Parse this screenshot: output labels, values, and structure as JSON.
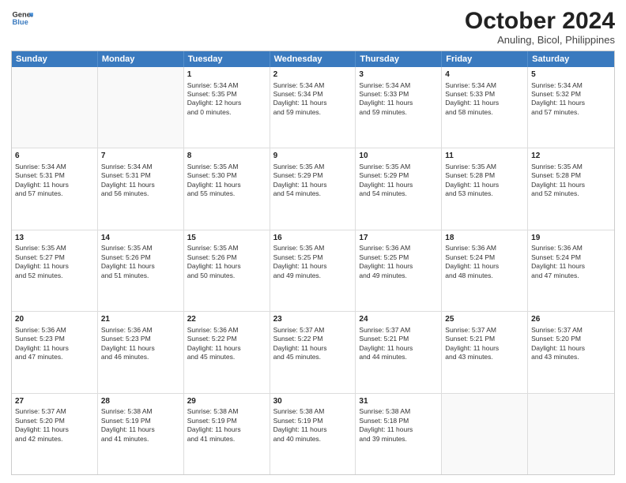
{
  "logo": {
    "line1": "General",
    "line2": "Blue"
  },
  "title": "October 2024",
  "subtitle": "Anuling, Bicol, Philippines",
  "days_of_week": [
    "Sunday",
    "Monday",
    "Tuesday",
    "Wednesday",
    "Thursday",
    "Friday",
    "Saturday"
  ],
  "weeks": [
    [
      {
        "day": "",
        "lines": []
      },
      {
        "day": "",
        "lines": []
      },
      {
        "day": "1",
        "lines": [
          "Sunrise: 5:34 AM",
          "Sunset: 5:35 PM",
          "Daylight: 12 hours",
          "and 0 minutes."
        ]
      },
      {
        "day": "2",
        "lines": [
          "Sunrise: 5:34 AM",
          "Sunset: 5:34 PM",
          "Daylight: 11 hours",
          "and 59 minutes."
        ]
      },
      {
        "day": "3",
        "lines": [
          "Sunrise: 5:34 AM",
          "Sunset: 5:33 PM",
          "Daylight: 11 hours",
          "and 59 minutes."
        ]
      },
      {
        "day": "4",
        "lines": [
          "Sunrise: 5:34 AM",
          "Sunset: 5:33 PM",
          "Daylight: 11 hours",
          "and 58 minutes."
        ]
      },
      {
        "day": "5",
        "lines": [
          "Sunrise: 5:34 AM",
          "Sunset: 5:32 PM",
          "Daylight: 11 hours",
          "and 57 minutes."
        ]
      }
    ],
    [
      {
        "day": "6",
        "lines": [
          "Sunrise: 5:34 AM",
          "Sunset: 5:31 PM",
          "Daylight: 11 hours",
          "and 57 minutes."
        ]
      },
      {
        "day": "7",
        "lines": [
          "Sunrise: 5:34 AM",
          "Sunset: 5:31 PM",
          "Daylight: 11 hours",
          "and 56 minutes."
        ]
      },
      {
        "day": "8",
        "lines": [
          "Sunrise: 5:35 AM",
          "Sunset: 5:30 PM",
          "Daylight: 11 hours",
          "and 55 minutes."
        ]
      },
      {
        "day": "9",
        "lines": [
          "Sunrise: 5:35 AM",
          "Sunset: 5:29 PM",
          "Daylight: 11 hours",
          "and 54 minutes."
        ]
      },
      {
        "day": "10",
        "lines": [
          "Sunrise: 5:35 AM",
          "Sunset: 5:29 PM",
          "Daylight: 11 hours",
          "and 54 minutes."
        ]
      },
      {
        "day": "11",
        "lines": [
          "Sunrise: 5:35 AM",
          "Sunset: 5:28 PM",
          "Daylight: 11 hours",
          "and 53 minutes."
        ]
      },
      {
        "day": "12",
        "lines": [
          "Sunrise: 5:35 AM",
          "Sunset: 5:28 PM",
          "Daylight: 11 hours",
          "and 52 minutes."
        ]
      }
    ],
    [
      {
        "day": "13",
        "lines": [
          "Sunrise: 5:35 AM",
          "Sunset: 5:27 PM",
          "Daylight: 11 hours",
          "and 52 minutes."
        ]
      },
      {
        "day": "14",
        "lines": [
          "Sunrise: 5:35 AM",
          "Sunset: 5:26 PM",
          "Daylight: 11 hours",
          "and 51 minutes."
        ]
      },
      {
        "day": "15",
        "lines": [
          "Sunrise: 5:35 AM",
          "Sunset: 5:26 PM",
          "Daylight: 11 hours",
          "and 50 minutes."
        ]
      },
      {
        "day": "16",
        "lines": [
          "Sunrise: 5:35 AM",
          "Sunset: 5:25 PM",
          "Daylight: 11 hours",
          "and 49 minutes."
        ]
      },
      {
        "day": "17",
        "lines": [
          "Sunrise: 5:36 AM",
          "Sunset: 5:25 PM",
          "Daylight: 11 hours",
          "and 49 minutes."
        ]
      },
      {
        "day": "18",
        "lines": [
          "Sunrise: 5:36 AM",
          "Sunset: 5:24 PM",
          "Daylight: 11 hours",
          "and 48 minutes."
        ]
      },
      {
        "day": "19",
        "lines": [
          "Sunrise: 5:36 AM",
          "Sunset: 5:24 PM",
          "Daylight: 11 hours",
          "and 47 minutes."
        ]
      }
    ],
    [
      {
        "day": "20",
        "lines": [
          "Sunrise: 5:36 AM",
          "Sunset: 5:23 PM",
          "Daylight: 11 hours",
          "and 47 minutes."
        ]
      },
      {
        "day": "21",
        "lines": [
          "Sunrise: 5:36 AM",
          "Sunset: 5:23 PM",
          "Daylight: 11 hours",
          "and 46 minutes."
        ]
      },
      {
        "day": "22",
        "lines": [
          "Sunrise: 5:36 AM",
          "Sunset: 5:22 PM",
          "Daylight: 11 hours",
          "and 45 minutes."
        ]
      },
      {
        "day": "23",
        "lines": [
          "Sunrise: 5:37 AM",
          "Sunset: 5:22 PM",
          "Daylight: 11 hours",
          "and 45 minutes."
        ]
      },
      {
        "day": "24",
        "lines": [
          "Sunrise: 5:37 AM",
          "Sunset: 5:21 PM",
          "Daylight: 11 hours",
          "and 44 minutes."
        ]
      },
      {
        "day": "25",
        "lines": [
          "Sunrise: 5:37 AM",
          "Sunset: 5:21 PM",
          "Daylight: 11 hours",
          "and 43 minutes."
        ]
      },
      {
        "day": "26",
        "lines": [
          "Sunrise: 5:37 AM",
          "Sunset: 5:20 PM",
          "Daylight: 11 hours",
          "and 43 minutes."
        ]
      }
    ],
    [
      {
        "day": "27",
        "lines": [
          "Sunrise: 5:37 AM",
          "Sunset: 5:20 PM",
          "Daylight: 11 hours",
          "and 42 minutes."
        ]
      },
      {
        "day": "28",
        "lines": [
          "Sunrise: 5:38 AM",
          "Sunset: 5:19 PM",
          "Daylight: 11 hours",
          "and 41 minutes."
        ]
      },
      {
        "day": "29",
        "lines": [
          "Sunrise: 5:38 AM",
          "Sunset: 5:19 PM",
          "Daylight: 11 hours",
          "and 41 minutes."
        ]
      },
      {
        "day": "30",
        "lines": [
          "Sunrise: 5:38 AM",
          "Sunset: 5:19 PM",
          "Daylight: 11 hours",
          "and 40 minutes."
        ]
      },
      {
        "day": "31",
        "lines": [
          "Sunrise: 5:38 AM",
          "Sunset: 5:18 PM",
          "Daylight: 11 hours",
          "and 39 minutes."
        ]
      },
      {
        "day": "",
        "lines": []
      },
      {
        "day": "",
        "lines": []
      }
    ]
  ]
}
